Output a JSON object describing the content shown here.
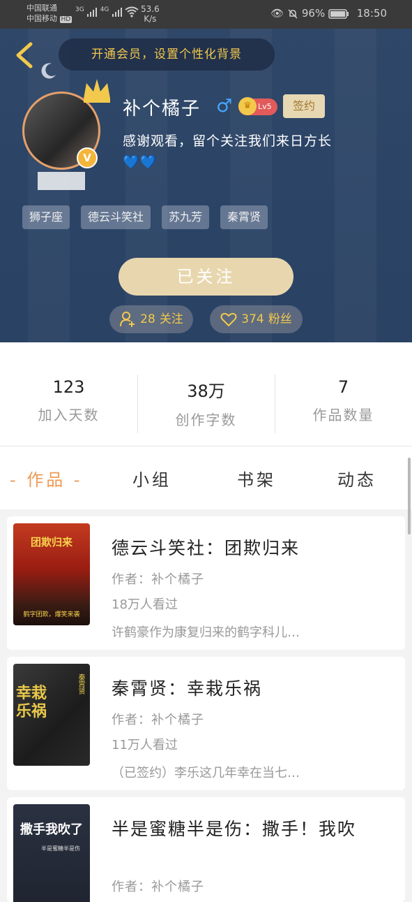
{
  "status_bar": {
    "carrier_1": "中国联通",
    "carrier_2": "中国移动",
    "hd_label": "HD",
    "net_1": "3G",
    "net_2": "4G",
    "speed_value": "53.6",
    "speed_unit": "K/s",
    "battery": "96%",
    "time": "18:50"
  },
  "header": {
    "vip_banner": "开通会员，设置个性化背景",
    "username": "补个橘子",
    "gender_symbol": "♂",
    "level": "Lv5",
    "signed_label": "签约",
    "bio": "感谢观看，留个关注我们来日方长",
    "bio_hearts": "💙💙",
    "avatar_badge": "V",
    "tags": [
      "狮子座",
      "德云斗笑社",
      "苏九芳",
      "秦霄贤"
    ],
    "follow_button": "已关注",
    "following_count": "28",
    "following_label": "关注",
    "fans_count": "374",
    "fans_label": "粉丝"
  },
  "stats": [
    {
      "value": "123",
      "label": "加入天数"
    },
    {
      "value": "38万",
      "label": "创作字数"
    },
    {
      "value": "7",
      "label": "作品数量"
    }
  ],
  "tabs": [
    {
      "label": "- 作品 -",
      "active": true
    },
    {
      "label": "小组",
      "active": false
    },
    {
      "label": "书架",
      "active": false
    },
    {
      "label": "动态",
      "active": false
    }
  ],
  "works": [
    {
      "title": "德云斗笑社：团欺归来",
      "author": "作者：补个橘子",
      "views": "18万人看过",
      "desc": "许鹤豪作为康复归来的鹤字科儿…",
      "cover_text": "团欺归来",
      "cover_sub": "鹤字团欺，爆笑来袭"
    },
    {
      "title": "秦霄贤：幸栽乐祸",
      "author": "作者：补个橘子",
      "views": "11万人看过",
      "desc": "（已签约）李乐这几年幸在当七…",
      "cover_text": "幸栽乐祸",
      "cover_sub": "秦霄贤"
    },
    {
      "title": "半是蜜糖半是伤：撒手！我吹",
      "author": "作者：补个橘子",
      "views": "",
      "desc": "",
      "cover_text": "撒手我吹了",
      "cover_sub": "半是蜜糖半是伤"
    }
  ],
  "colors": {
    "header_bg": "#2c4466",
    "accent_orange": "#f09a54",
    "gold": "#f2c94c",
    "follow_bg": "#e8d7ae"
  }
}
